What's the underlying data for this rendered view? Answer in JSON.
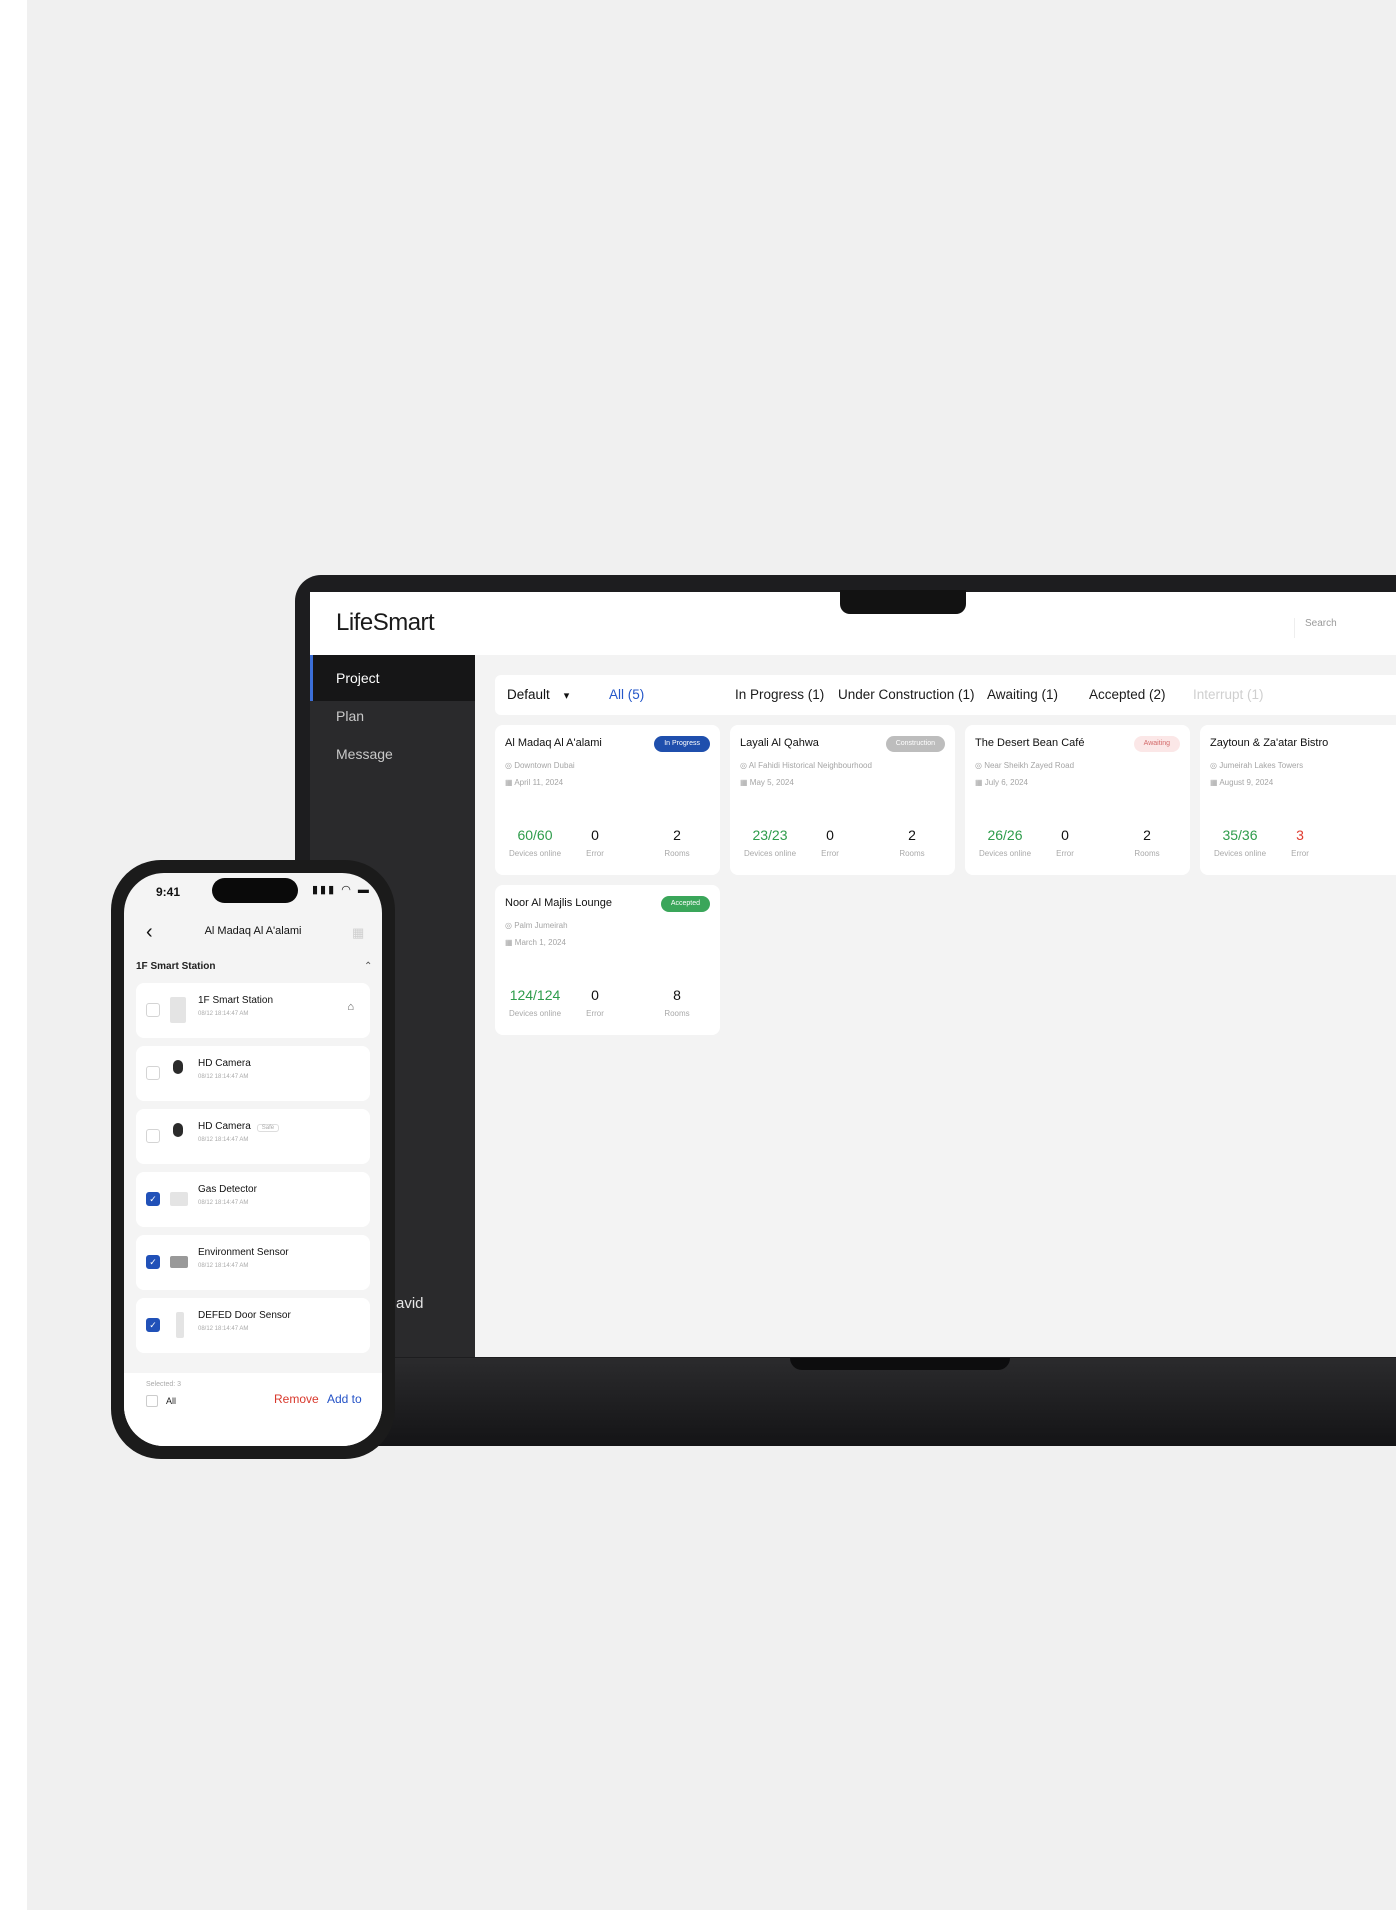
{
  "app": {
    "logo": "LifeSmart",
    "search_placeholder": "Search"
  },
  "sidebar": {
    "items": [
      {
        "label": "Project"
      },
      {
        "label": "Plan"
      },
      {
        "label": "Message"
      }
    ],
    "user_partial": "avid"
  },
  "filters": {
    "default_label": "Default",
    "tabs": [
      {
        "label": "All (5)"
      },
      {
        "label": "In Progress (1)"
      },
      {
        "label": "Under Construction (1)"
      },
      {
        "label": "Awaiting (1)"
      },
      {
        "label": "Accepted (2)"
      },
      {
        "label": "Interrupt (1)"
      }
    ]
  },
  "projects": [
    {
      "name": "Al Madaq Al A'alami",
      "status": "In Progress",
      "location": "Downtown Dubai",
      "date": "April 11, 2024",
      "devices": "60/60",
      "devices_label": "Devices online",
      "error": "0",
      "error_label": "Error",
      "rooms": "2",
      "rooms_label": "Rooms"
    },
    {
      "name": "Layali Al Qahwa",
      "status": "Construction",
      "location": "Al Fahidi Historical Neighbourhood",
      "date": "May 5, 2024",
      "devices": "23/23",
      "devices_label": "Devices online",
      "error": "0",
      "error_label": "Error",
      "rooms": "2",
      "rooms_label": "Rooms"
    },
    {
      "name": "The Desert Bean Café",
      "status": "Awaiting",
      "location": "Near Sheikh Zayed Road",
      "date": "July 6, 2024",
      "devices": "26/26",
      "devices_label": "Devices online",
      "error": "0",
      "error_label": "Error",
      "rooms": "2",
      "rooms_label": "Rooms"
    },
    {
      "name": "Zaytoun & Za'atar Bistro",
      "status": "",
      "location": "Jumeirah Lakes Towers",
      "date": "August 9, 2024",
      "devices": "35/36",
      "devices_label": "Devices online",
      "error": "3",
      "error_label": "Error",
      "rooms": "",
      "rooms_label": ""
    },
    {
      "name": "Noor Al Majlis Lounge",
      "status": "Accepted",
      "location": "Palm Jumeirah",
      "date": "March 1, 2024",
      "devices": "124/124",
      "devices_label": "Devices online",
      "error": "0",
      "error_label": "Error",
      "rooms": "8",
      "rooms_label": "Rooms"
    }
  ],
  "phone": {
    "time": "9:41",
    "status_icons": "signal wifi battery",
    "title": "Al Madaq Al A'alami",
    "section": "1F Smart Station",
    "devices": [
      {
        "name": "1F Smart Station",
        "time": "08/12 18:14:47 AM",
        "checked": false
      },
      {
        "name": "HD Camera",
        "time": "08/12 18:14:47 AM",
        "checked": false
      },
      {
        "name": "HD Camera",
        "tag": "Safe",
        "time": "08/12 18:14:47 AM",
        "checked": false
      },
      {
        "name": "Gas Detector",
        "time": "08/12 18:14:47 AM",
        "checked": true
      },
      {
        "name": "Environment Sensor",
        "time": "08/12 18:14:47 AM",
        "checked": true
      },
      {
        "name": "DEFED Door Sensor",
        "time": "08/12 18:14:47 AM",
        "checked": true
      }
    ],
    "footer": {
      "selected": "Selected: 3",
      "all": "All",
      "remove": "Remove",
      "add": "Add to"
    }
  },
  "colors": {
    "accent_blue": "#2457c9",
    "success_green": "#2e9c4b",
    "error_red": "#e03b2f",
    "sidebar_bg": "#2a2a2c"
  }
}
